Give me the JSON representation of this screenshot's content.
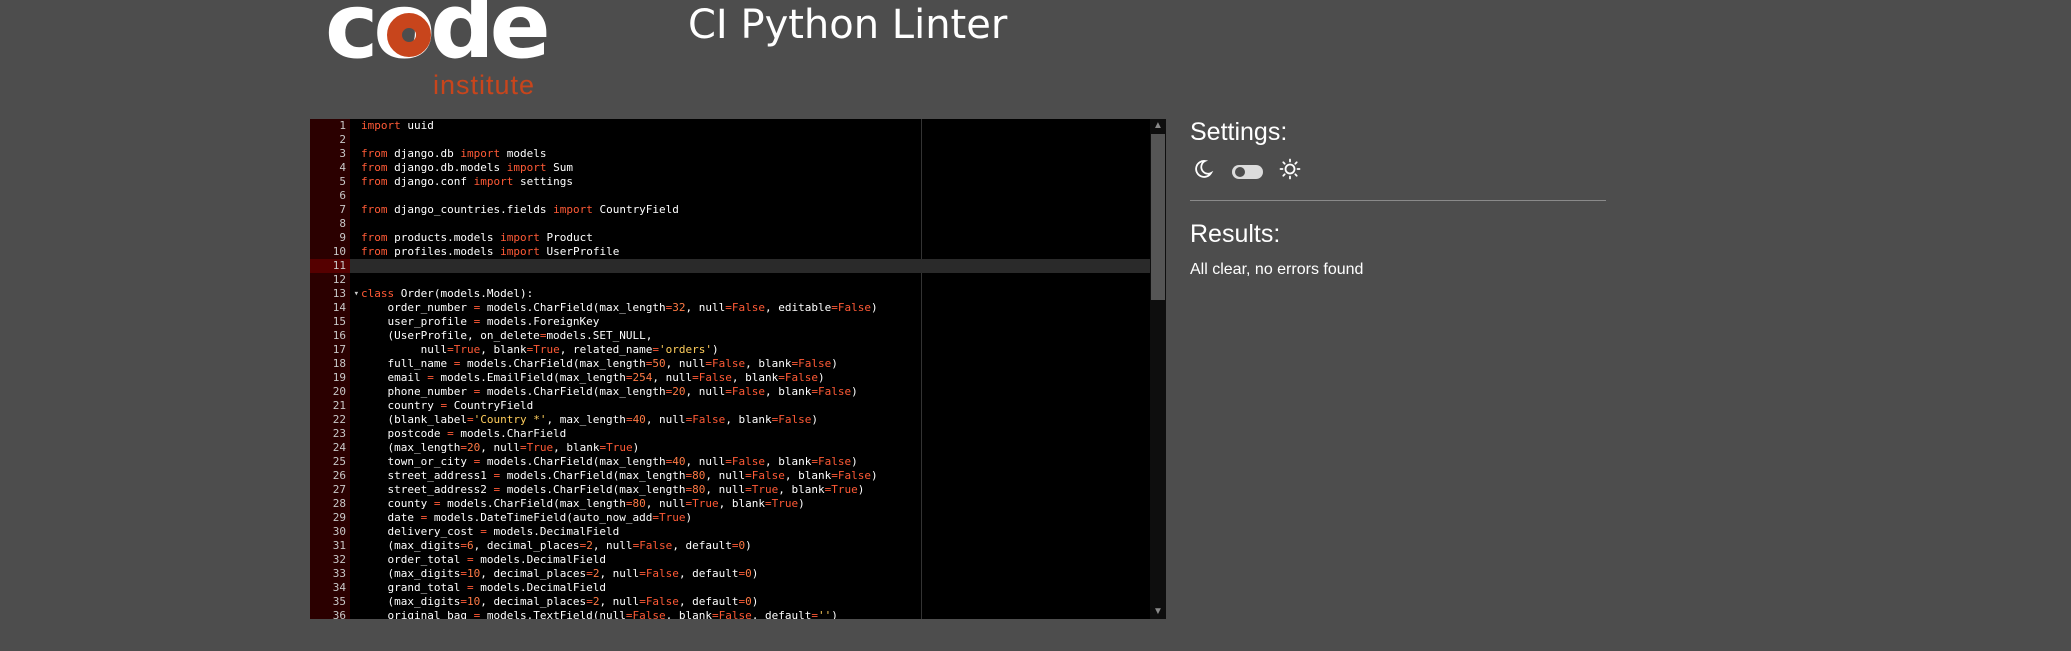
{
  "logo": {
    "word": "code",
    "sub": "institute"
  },
  "header": {
    "title": "CI Python Linter"
  },
  "settings": {
    "title": "Settings:",
    "theme_dark_icon": "moon-icon",
    "theme_toggle_icon": "toggle-icon",
    "theme_light_icon": "sun-icon"
  },
  "results": {
    "title": "Results:",
    "message": "All clear, no errors found"
  },
  "editor": {
    "active_line": 11,
    "fold_lines": [
      13
    ],
    "lines": [
      [
        [
          "kw",
          "import"
        ],
        [
          "t",
          " uuid"
        ]
      ],
      [],
      [
        [
          "kw",
          "from"
        ],
        [
          "t",
          " django.db "
        ],
        [
          "kw",
          "import"
        ],
        [
          "t",
          " models"
        ]
      ],
      [
        [
          "kw",
          "from"
        ],
        [
          "t",
          " django.db.models "
        ],
        [
          "kw",
          "import"
        ],
        [
          "t",
          " Sum"
        ]
      ],
      [
        [
          "kw",
          "from"
        ],
        [
          "t",
          " django.conf "
        ],
        [
          "kw",
          "import"
        ],
        [
          "t",
          " settings"
        ]
      ],
      [],
      [
        [
          "kw",
          "from"
        ],
        [
          "t",
          " django_countries.fields "
        ],
        [
          "kw",
          "import"
        ],
        [
          "t",
          " CountryField"
        ]
      ],
      [],
      [
        [
          "kw",
          "from"
        ],
        [
          "t",
          " products.models "
        ],
        [
          "kw",
          "import"
        ],
        [
          "t",
          " Product"
        ]
      ],
      [
        [
          "kw",
          "from"
        ],
        [
          "t",
          " profiles.models "
        ],
        [
          "kw",
          "import"
        ],
        [
          "t",
          " UserProfile"
        ]
      ],
      [],
      [],
      [
        [
          "kw",
          "class"
        ],
        [
          "t",
          " Order(models.Model):"
        ]
      ],
      [
        [
          "t",
          "    order_number "
        ],
        [
          "kw",
          "="
        ],
        [
          "t",
          " models.CharField(max_length"
        ],
        [
          "kw",
          "="
        ],
        [
          "num",
          "32"
        ],
        [
          "t",
          ", null"
        ],
        [
          "kw",
          "="
        ],
        [
          "kw",
          "False"
        ],
        [
          "t",
          ", editable"
        ],
        [
          "kw",
          "="
        ],
        [
          "kw",
          "False"
        ],
        [
          "t",
          ")"
        ]
      ],
      [
        [
          "t",
          "    user_profile "
        ],
        [
          "kw",
          "="
        ],
        [
          "t",
          " models.ForeignKey"
        ]
      ],
      [
        [
          "t",
          "    (UserProfile, on_delete"
        ],
        [
          "kw",
          "="
        ],
        [
          "t",
          "models.SET_NULL,"
        ]
      ],
      [
        [
          "t",
          "         null"
        ],
        [
          "kw",
          "="
        ],
        [
          "kw",
          "True"
        ],
        [
          "t",
          ", blank"
        ],
        [
          "kw",
          "="
        ],
        [
          "kw",
          "True"
        ],
        [
          "t",
          ", related_name"
        ],
        [
          "kw",
          "="
        ],
        [
          "str",
          "'orders'"
        ],
        [
          "t",
          ")"
        ]
      ],
      [
        [
          "t",
          "    full_name "
        ],
        [
          "kw",
          "="
        ],
        [
          "t",
          " models.CharField(max_length"
        ],
        [
          "kw",
          "="
        ],
        [
          "num",
          "50"
        ],
        [
          "t",
          ", null"
        ],
        [
          "kw",
          "="
        ],
        [
          "kw",
          "False"
        ],
        [
          "t",
          ", blank"
        ],
        [
          "kw",
          "="
        ],
        [
          "kw",
          "False"
        ],
        [
          "t",
          ")"
        ]
      ],
      [
        [
          "t",
          "    email "
        ],
        [
          "kw",
          "="
        ],
        [
          "t",
          " models.EmailField(max_length"
        ],
        [
          "kw",
          "="
        ],
        [
          "num",
          "254"
        ],
        [
          "t",
          ", null"
        ],
        [
          "kw",
          "="
        ],
        [
          "kw",
          "False"
        ],
        [
          "t",
          ", blank"
        ],
        [
          "kw",
          "="
        ],
        [
          "kw",
          "False"
        ],
        [
          "t",
          ")"
        ]
      ],
      [
        [
          "t",
          "    phone_number "
        ],
        [
          "kw",
          "="
        ],
        [
          "t",
          " models.CharField(max_length"
        ],
        [
          "kw",
          "="
        ],
        [
          "num",
          "20"
        ],
        [
          "t",
          ", null"
        ],
        [
          "kw",
          "="
        ],
        [
          "kw",
          "False"
        ],
        [
          "t",
          ", blank"
        ],
        [
          "kw",
          "="
        ],
        [
          "kw",
          "False"
        ],
        [
          "t",
          ")"
        ]
      ],
      [
        [
          "t",
          "    country "
        ],
        [
          "kw",
          "="
        ],
        [
          "t",
          " CountryField"
        ]
      ],
      [
        [
          "t",
          "    (blank_label"
        ],
        [
          "kw",
          "="
        ],
        [
          "str",
          "'Country *'"
        ],
        [
          "t",
          ", max_length"
        ],
        [
          "kw",
          "="
        ],
        [
          "num",
          "40"
        ],
        [
          "t",
          ", null"
        ],
        [
          "kw",
          "="
        ],
        [
          "kw",
          "False"
        ],
        [
          "t",
          ", blank"
        ],
        [
          "kw",
          "="
        ],
        [
          "kw",
          "False"
        ],
        [
          "t",
          ")"
        ]
      ],
      [
        [
          "t",
          "    postcode "
        ],
        [
          "kw",
          "="
        ],
        [
          "t",
          " models.CharField"
        ]
      ],
      [
        [
          "t",
          "    (max_length"
        ],
        [
          "kw",
          "="
        ],
        [
          "num",
          "20"
        ],
        [
          "t",
          ", null"
        ],
        [
          "kw",
          "="
        ],
        [
          "kw",
          "True"
        ],
        [
          "t",
          ", blank"
        ],
        [
          "kw",
          "="
        ],
        [
          "kw",
          "True"
        ],
        [
          "t",
          ")"
        ]
      ],
      [
        [
          "t",
          "    town_or_city "
        ],
        [
          "kw",
          "="
        ],
        [
          "t",
          " models.CharField(max_length"
        ],
        [
          "kw",
          "="
        ],
        [
          "num",
          "40"
        ],
        [
          "t",
          ", null"
        ],
        [
          "kw",
          "="
        ],
        [
          "kw",
          "False"
        ],
        [
          "t",
          ", blank"
        ],
        [
          "kw",
          "="
        ],
        [
          "kw",
          "False"
        ],
        [
          "t",
          ")"
        ]
      ],
      [
        [
          "t",
          "    street_address1 "
        ],
        [
          "kw",
          "="
        ],
        [
          "t",
          " models.CharField(max_length"
        ],
        [
          "kw",
          "="
        ],
        [
          "num",
          "80"
        ],
        [
          "t",
          ", null"
        ],
        [
          "kw",
          "="
        ],
        [
          "kw",
          "False"
        ],
        [
          "t",
          ", blank"
        ],
        [
          "kw",
          "="
        ],
        [
          "kw",
          "False"
        ],
        [
          "t",
          ")"
        ]
      ],
      [
        [
          "t",
          "    street_address2 "
        ],
        [
          "kw",
          "="
        ],
        [
          "t",
          " models.CharField(max_length"
        ],
        [
          "kw",
          "="
        ],
        [
          "num",
          "80"
        ],
        [
          "t",
          ", null"
        ],
        [
          "kw",
          "="
        ],
        [
          "kw",
          "True"
        ],
        [
          "t",
          ", blank"
        ],
        [
          "kw",
          "="
        ],
        [
          "kw",
          "True"
        ],
        [
          "t",
          ")"
        ]
      ],
      [
        [
          "t",
          "    county "
        ],
        [
          "kw",
          "="
        ],
        [
          "t",
          " models.CharField(max_length"
        ],
        [
          "kw",
          "="
        ],
        [
          "num",
          "80"
        ],
        [
          "t",
          ", null"
        ],
        [
          "kw",
          "="
        ],
        [
          "kw",
          "True"
        ],
        [
          "t",
          ", blank"
        ],
        [
          "kw",
          "="
        ],
        [
          "kw",
          "True"
        ],
        [
          "t",
          ")"
        ]
      ],
      [
        [
          "t",
          "    date "
        ],
        [
          "kw",
          "="
        ],
        [
          "t",
          " models.DateTimeField(auto_now_add"
        ],
        [
          "kw",
          "="
        ],
        [
          "kw",
          "True"
        ],
        [
          "t",
          ")"
        ]
      ],
      [
        [
          "t",
          "    delivery_cost "
        ],
        [
          "kw",
          "="
        ],
        [
          "t",
          " models.DecimalField"
        ]
      ],
      [
        [
          "t",
          "    (max_digits"
        ],
        [
          "kw",
          "="
        ],
        [
          "num",
          "6"
        ],
        [
          "t",
          ", decimal_places"
        ],
        [
          "kw",
          "="
        ],
        [
          "num",
          "2"
        ],
        [
          "t",
          ", null"
        ],
        [
          "kw",
          "="
        ],
        [
          "kw",
          "False"
        ],
        [
          "t",
          ", default"
        ],
        [
          "kw",
          "="
        ],
        [
          "num",
          "0"
        ],
        [
          "t",
          ")"
        ]
      ],
      [
        [
          "t",
          "    order_total "
        ],
        [
          "kw",
          "="
        ],
        [
          "t",
          " models.DecimalField"
        ]
      ],
      [
        [
          "t",
          "    (max_digits"
        ],
        [
          "kw",
          "="
        ],
        [
          "num",
          "10"
        ],
        [
          "t",
          ", decimal_places"
        ],
        [
          "kw",
          "="
        ],
        [
          "num",
          "2"
        ],
        [
          "t",
          ", null"
        ],
        [
          "kw",
          "="
        ],
        [
          "kw",
          "False"
        ],
        [
          "t",
          ", default"
        ],
        [
          "kw",
          "="
        ],
        [
          "num",
          "0"
        ],
        [
          "t",
          ")"
        ]
      ],
      [
        [
          "t",
          "    grand_total "
        ],
        [
          "kw",
          "="
        ],
        [
          "t",
          " models.DecimalField"
        ]
      ],
      [
        [
          "t",
          "    (max_digits"
        ],
        [
          "kw",
          "="
        ],
        [
          "num",
          "10"
        ],
        [
          "t",
          ", decimal_places"
        ],
        [
          "kw",
          "="
        ],
        [
          "num",
          "2"
        ],
        [
          "t",
          ", null"
        ],
        [
          "kw",
          "="
        ],
        [
          "kw",
          "False"
        ],
        [
          "t",
          ", default"
        ],
        [
          "kw",
          "="
        ],
        [
          "num",
          "0"
        ],
        [
          "t",
          ")"
        ]
      ],
      [
        [
          "t",
          "    original_bag "
        ],
        [
          "kw",
          "="
        ],
        [
          "t",
          " models.TextField(null"
        ],
        [
          "kw",
          "="
        ],
        [
          "kw",
          "False"
        ],
        [
          "t",
          ", blank"
        ],
        [
          "kw",
          "="
        ],
        [
          "kw",
          "False"
        ],
        [
          "t",
          ", default"
        ],
        [
          "kw",
          "="
        ],
        [
          "str",
          "''"
        ],
        [
          "t",
          ")"
        ]
      ]
    ]
  }
}
